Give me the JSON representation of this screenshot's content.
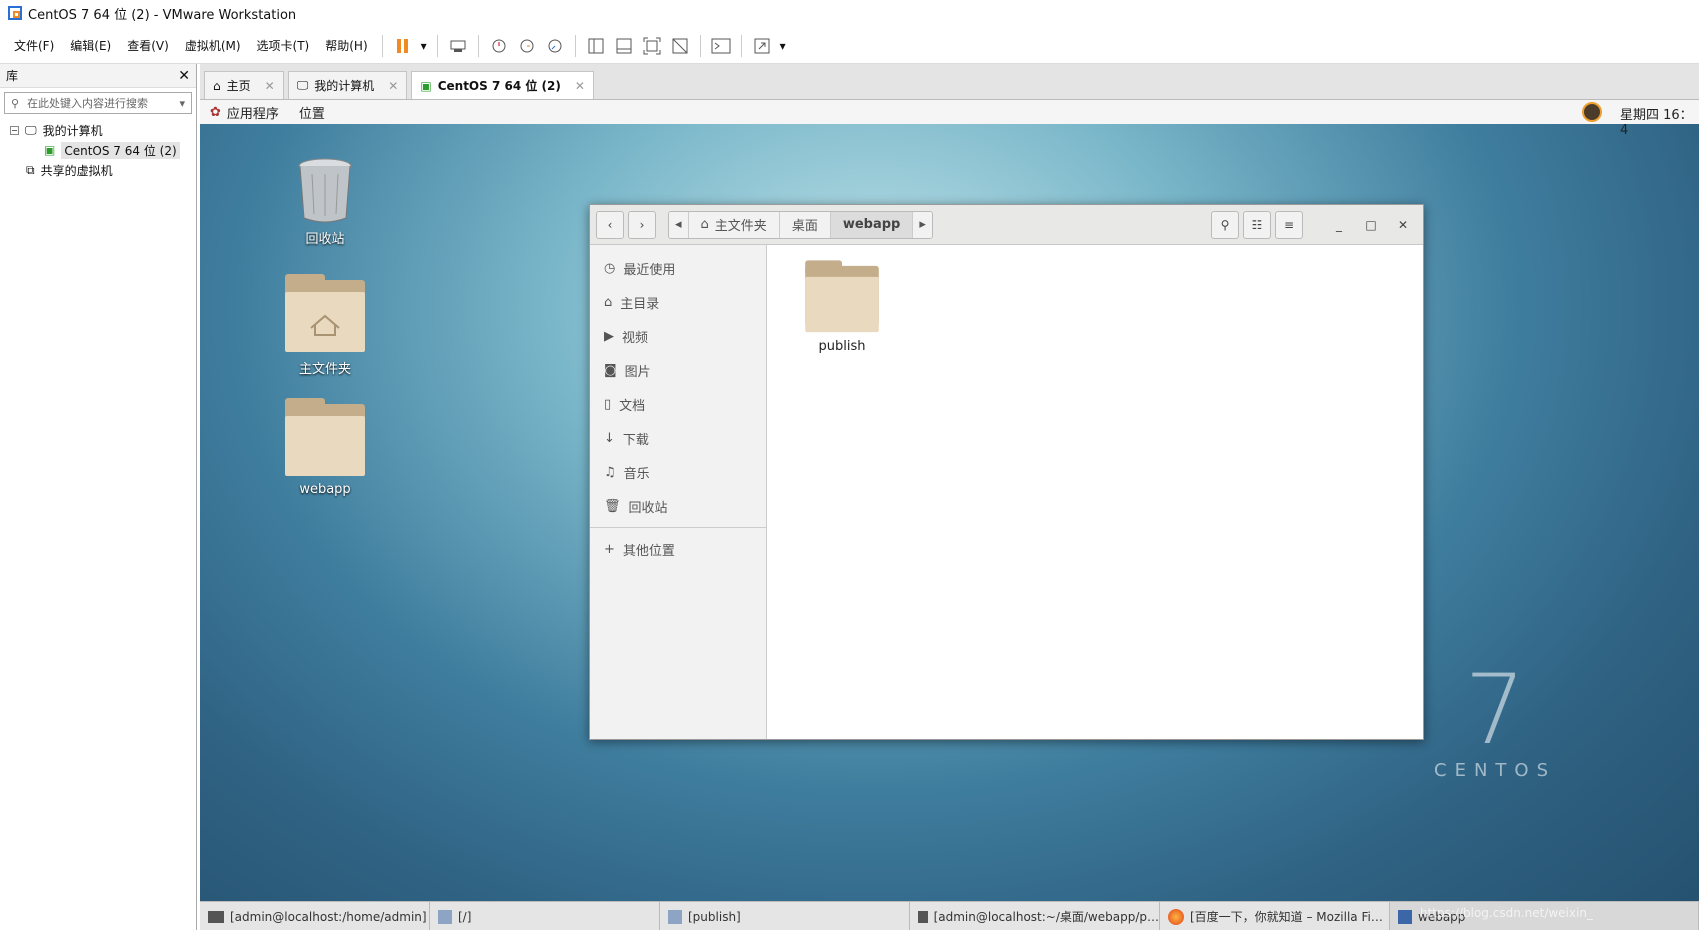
{
  "window": {
    "title": "CentOS 7 64 位 (2) - VMware Workstation"
  },
  "menu": [
    "文件(F)",
    "编辑(E)",
    "查看(V)",
    "虚拟机(M)",
    "选项卡(T)",
    "帮助(H)"
  ],
  "library": {
    "title": "库",
    "search_placeholder": "在此处键入内容进行搜索",
    "tree": {
      "root": "我的计算机",
      "vm": "CentOS 7 64 位 (2)",
      "shared": "共享的虚拟机"
    }
  },
  "tabs": [
    {
      "label": "主页"
    },
    {
      "label": "我的计算机"
    },
    {
      "label": "CentOS 7 64 位 (2)"
    }
  ],
  "gnome": {
    "apps": "应用程序",
    "places": "位置",
    "clock": "星期四 16：4"
  },
  "desktop": {
    "trash": "回收站",
    "home": "主文件夹",
    "webapp": "webapp"
  },
  "files": {
    "breadcrumbs": [
      "主文件夹",
      "桌面",
      "webapp"
    ],
    "sidebar": [
      "最近使用",
      "主目录",
      "视频",
      "图片",
      "文档",
      "下载",
      "音乐",
      "回收站"
    ],
    "other": "其他位置",
    "items": [
      {
        "name": "publish"
      }
    ]
  },
  "taskbar": [
    "[admin@localhost:/home/admin]",
    "[/]",
    "[publish]",
    "[admin@localhost:~/桌面/webapp/p…",
    "[百度一下，你就知道 – Mozilla Fi…",
    "webapp"
  ],
  "watermark": "https://blog.csdn.net/weixin_",
  "centos_brand": {
    "numeral": "7",
    "word": "CENTOS"
  },
  "colors": {
    "vmware_accent": "#f08a24",
    "folder": "#e9d9bf"
  }
}
